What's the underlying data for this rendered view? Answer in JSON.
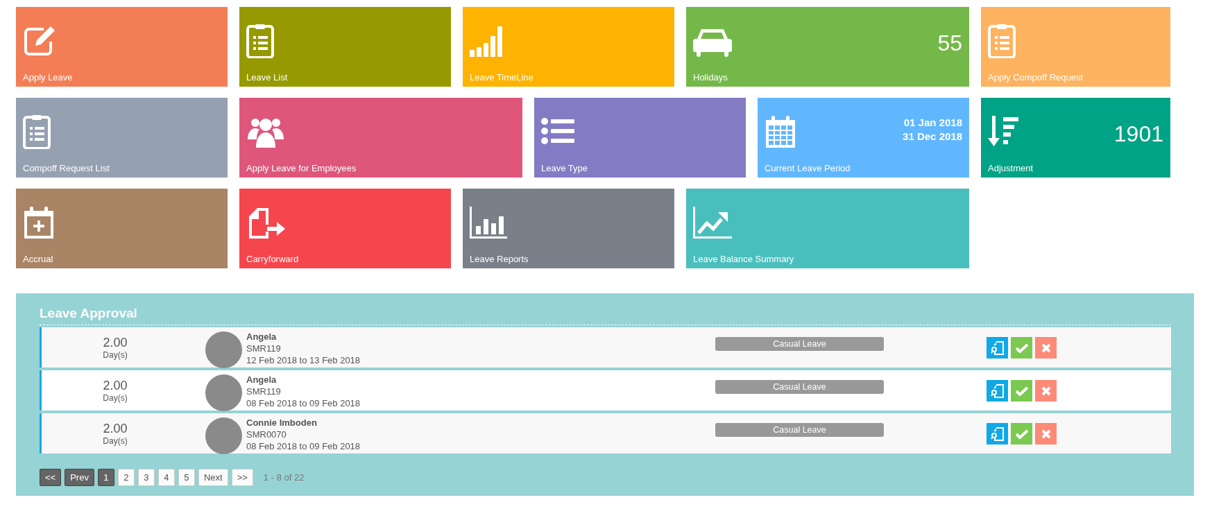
{
  "tile_rows": [
    [
      {
        "label": "Apply Leave",
        "color": "#f37e56"
      },
      {
        "label": "Leave List",
        "color": "#969a00"
      },
      {
        "label": "Leave TimeLine",
        "color": "#feb300"
      },
      {
        "label": "Holidays",
        "color": "#75b84a",
        "value": "55"
      },
      {
        "label": "Apply Compoff Request",
        "color": "#fdb35f"
      }
    ],
    [
      {
        "label": "Compoff Request List",
        "color": "#95a0b1"
      },
      {
        "label": "Apply Leave for Employees",
        "color": "#de577b"
      },
      {
        "label": "Leave Type",
        "color": "#837cc4"
      },
      {
        "label": "Current Leave Period",
        "color": "#61b7fe",
        "dates": [
          "01 Jan 2018",
          "31 Dec 2018"
        ]
      },
      {
        "label": "Adjustment",
        "color": "#00a386",
        "value": "1901"
      }
    ],
    [
      {
        "label": "Accrual",
        "color": "#a98465"
      },
      {
        "label": "Carryforward",
        "color": "#f6464d"
      },
      {
        "label": "Leave Reports",
        "color": "#7a808a"
      },
      {
        "label": "Leave Balance Summary",
        "color": "#49bfbd"
      }
    ]
  ],
  "leave_approval": {
    "title": "Leave Approval",
    "rows": [
      {
        "days": "2.00",
        "unit": "Day(s)",
        "name": "Angela",
        "code": "SMR119",
        "period": "12 Feb 2018 to 13 Feb 2018",
        "leave_type": "Casual Leave"
      },
      {
        "days": "2.00",
        "unit": "Day(s)",
        "name": "Angela",
        "code": "SMR119",
        "period": "08 Feb 2018 to 09 Feb 2018",
        "leave_type": "Casual Leave"
      },
      {
        "days": "2.00",
        "unit": "Day(s)",
        "name": "Connie Imboden",
        "code": "SMR0070",
        "period": "08 Feb 2018 to 09 Feb 2018",
        "leave_type": "Casual Leave"
      }
    ],
    "pagination": {
      "buttons": [
        {
          "label": "<<",
          "kind": "nav",
          "disabled": true
        },
        {
          "label": "Prev",
          "kind": "nav",
          "disabled": true
        },
        {
          "label": "1",
          "kind": "page",
          "selected": true
        },
        {
          "label": "2",
          "kind": "page",
          "selected": false
        },
        {
          "label": "3",
          "kind": "page",
          "selected": false
        },
        {
          "label": "4",
          "kind": "page",
          "selected": false
        },
        {
          "label": "5",
          "kind": "page",
          "selected": false
        },
        {
          "label": "Next",
          "kind": "nav",
          "disabled": false
        },
        {
          "label": ">>",
          "kind": "nav",
          "disabled": false
        }
      ],
      "summary": "1 - 8 of 22"
    }
  }
}
